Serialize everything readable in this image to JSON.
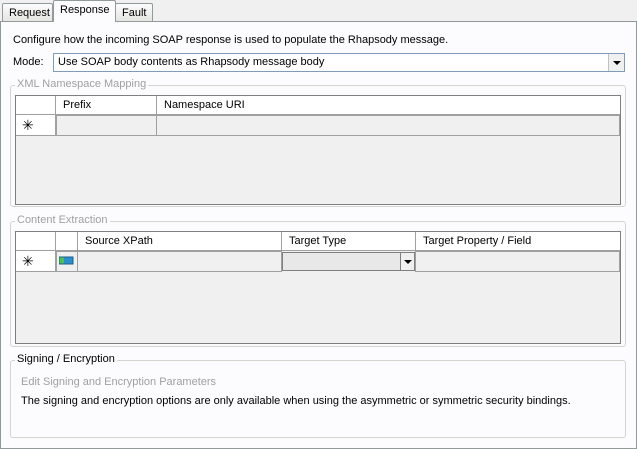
{
  "tabs": [
    "Request",
    "Response",
    "Fault"
  ],
  "active_tab": "Response",
  "intro": "Configure how the incoming SOAP response is used to populate the Rhapsody message.",
  "mode": {
    "label": "Mode:",
    "value": "Use SOAP body contents as Rhapsody message body"
  },
  "namespace_mapping": {
    "title": "XML Namespace Mapping",
    "columns": [
      "Prefix",
      "Namespace URI"
    ],
    "new_row_marker": "✳"
  },
  "content_extraction": {
    "title": "Content Extraction",
    "columns": [
      "Source XPath",
      "Target Type",
      "Target Property / Field"
    ],
    "new_row_marker": "✳"
  },
  "signing": {
    "title": "Signing / Encryption",
    "link": "Edit Signing and Encryption Parameters",
    "note": "The signing and encryption options are only available when using the asymmetric or symmetric security bindings."
  }
}
